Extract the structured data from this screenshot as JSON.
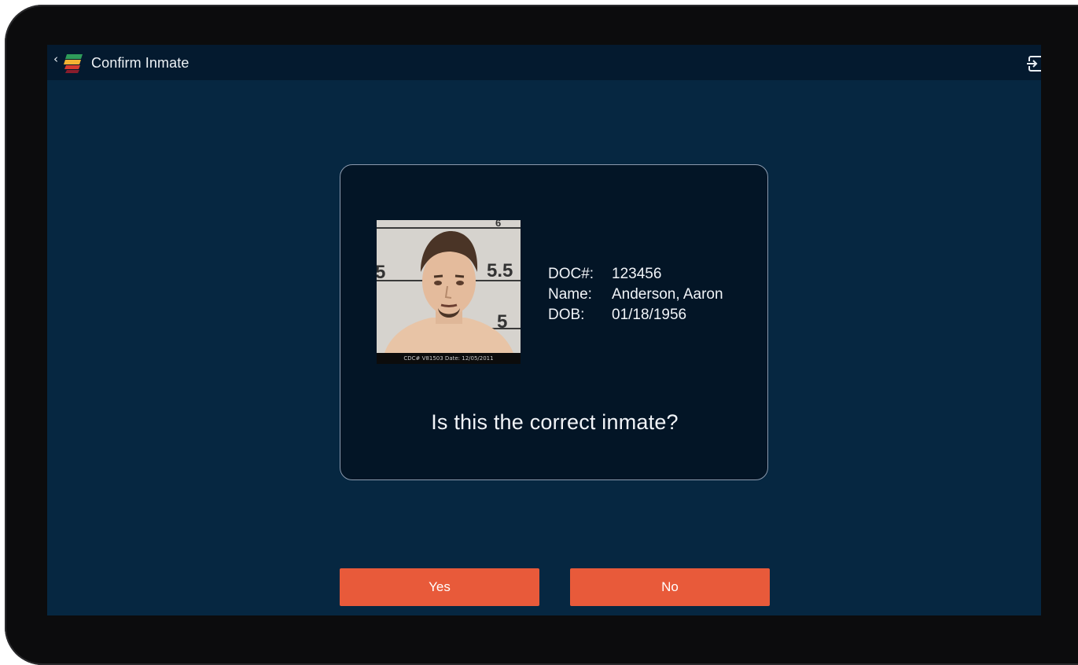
{
  "header": {
    "back_glyph": "‹",
    "title": "Confirm Inmate",
    "back_icon": "chevron-left-icon",
    "logo_icon": "app-logo-icon",
    "logout_icon": "logout-icon"
  },
  "inmate": {
    "photo_caption": "CDC# V81503  Date: 12/05/2011",
    "height_marks": [
      "5",
      "5.5",
      "5"
    ],
    "fields": [
      {
        "label": "DOC#:",
        "value": "123456"
      },
      {
        "label": "Name:",
        "value": "Anderson, Aaron"
      },
      {
        "label": "DOB:",
        "value": "01/18/1956"
      }
    ]
  },
  "prompt": "Is this the correct inmate?",
  "actions": {
    "yes_label": "Yes",
    "no_label": "No"
  },
  "colors": {
    "screen_bg": "#062741",
    "topbar_bg": "#041a2f",
    "card_bg": "#031526",
    "accent": "#e85a3a"
  }
}
